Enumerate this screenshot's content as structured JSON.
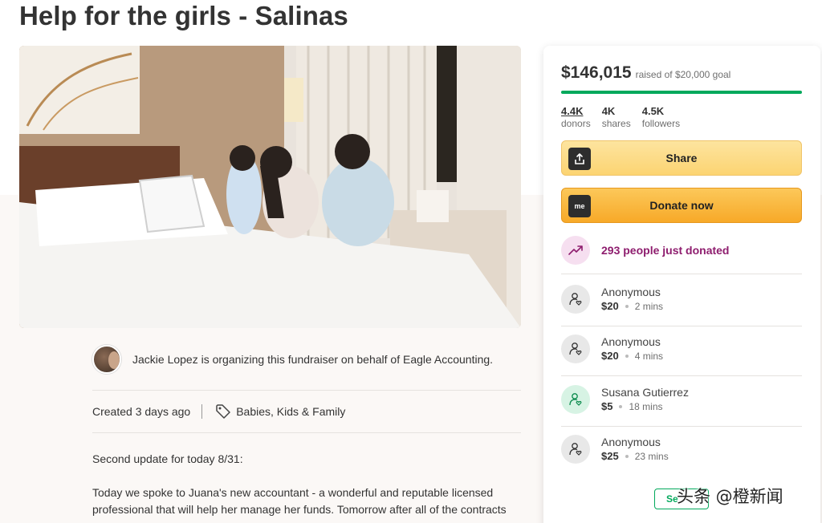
{
  "page": {
    "title": "Help for the girls - Salinas"
  },
  "organizer": {
    "text": "Jackie Lopez is organizing this fundraiser on behalf of Eagle Accounting."
  },
  "meta": {
    "created": "Created 3 days ago",
    "category": "Babies, Kids & Family"
  },
  "story": {
    "paragraphs": [
      "Second update for today 8/31:",
      "Today we spoke to Juana's new accountant - a wonderful and reputable licensed professional that will help her manage her funds. Tomorrow after all of the contracts"
    ]
  },
  "donation_card": {
    "raised": "$146,015",
    "goal_text": "raised of $20,000 goal",
    "progress_fraction": 1.0,
    "stats": [
      {
        "value": "4.4K",
        "label": "donors"
      },
      {
        "value": "4K",
        "label": "shares"
      },
      {
        "value": "4.5K",
        "label": "followers"
      }
    ],
    "share_label": "Share",
    "donate_label": "Donate now",
    "donate_icon_text": "me",
    "just_donated": "293 people just donated",
    "donations": [
      {
        "name": "Anonymous",
        "amount": "$20",
        "time": "2 mins"
      },
      {
        "name": "Anonymous",
        "amount": "$20",
        "time": "4 mins"
      },
      {
        "name": "Susana Gutierrez",
        "amount": "$5",
        "time": "18 mins"
      },
      {
        "name": "Anonymous",
        "amount": "$25",
        "time": "23 mins"
      }
    ],
    "see_all_label": "Se"
  },
  "watermark": "头条 @橙新闻",
  "colors": {
    "accent_green": "#02a95c",
    "donate_orange": "#f7a928",
    "share_yellow": "#fcd472",
    "trend_purple": "#8e1d6e"
  }
}
